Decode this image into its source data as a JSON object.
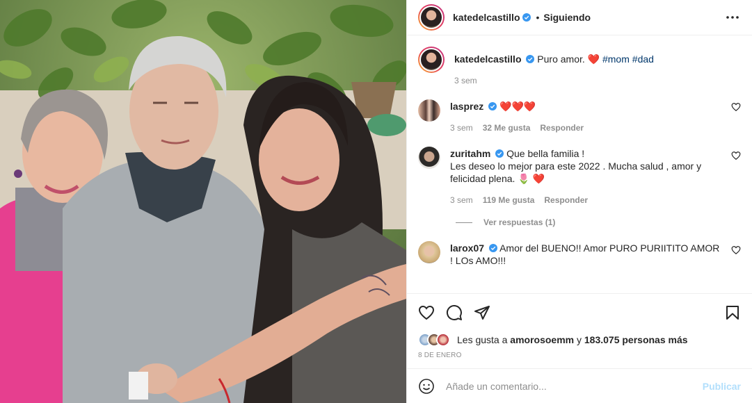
{
  "post": {
    "author": "katedelcastillo",
    "separator": "•",
    "follow_status": "Siguiendo",
    "more_icon": "more-horizontal-icon"
  },
  "caption": {
    "username": "katedelcastillo",
    "text": "Puro amor.",
    "emoji": "❤️",
    "hashtags": [
      "#mom",
      "#dad"
    ],
    "time": "3 sem"
  },
  "comments": [
    {
      "username": "lasprez",
      "text": "❤️❤️❤️",
      "time": "3 sem",
      "likes": "32 Me gusta",
      "reply_label": "Responder",
      "avatar_color": "#c97f68"
    },
    {
      "username": "zuritahm",
      "text": "Que bella familia !",
      "text2": "Les deseo lo mejor para este 2022 . Mucha salud , amor y felicidad plena. 🌷 ❤️",
      "time": "3 sem",
      "likes": "119 Me gusta",
      "reply_label": "Responder",
      "view_replies": "Ver respuestas (1)",
      "avatar_color": "#8a7d70"
    },
    {
      "username": "larox07",
      "text": "Amor del BUENO!! Amor PURO PURIITITO AMOR ! LOs AMO!!!",
      "avatar_color": "#d7b38c"
    }
  ],
  "likes": {
    "prefix": "Les gusta a",
    "user": "amorosoemm",
    "connector": "y",
    "count": "183.075 personas más"
  },
  "date": "8 DE ENERO",
  "add_comment": {
    "placeholder": "Añade un comentario...",
    "publish": "Publicar"
  },
  "colors": {
    "accent_link": "#00376b",
    "verified": "#3897f0",
    "heart": "#ed4956",
    "publish_disabled": "#b2dffc",
    "muted": "#8e8e8e"
  }
}
